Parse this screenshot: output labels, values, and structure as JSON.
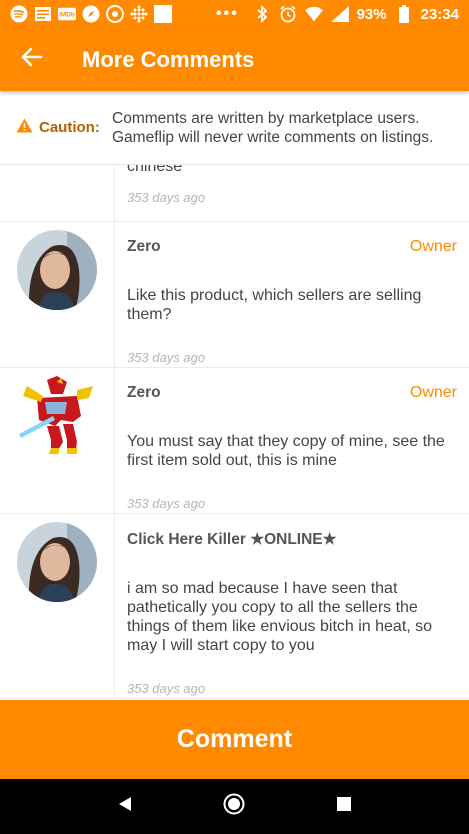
{
  "status_bar": {
    "battery": "93%",
    "time": "23:34",
    "dots": "•••"
  },
  "app_bar": {
    "title": "More Comments"
  },
  "caution": {
    "label": "Caution:",
    "text_line1": "Comments are written by marketplace users.",
    "text_line2": "Gameflip will never write comments on listings."
  },
  "comments": [
    {
      "text": "chinese",
      "time": "353 days ago"
    },
    {
      "author": "Zero",
      "role": "Owner",
      "text": "Like this product, which sellers are selling them?",
      "time": "353 days ago"
    },
    {
      "author": "Zero",
      "role": "Owner",
      "text": "You must say that they copy of mine, see the first item sold out, this is mine",
      "time": "353 days ago"
    },
    {
      "author": "Click Here Killer ★ONLINE★",
      "text": "i am so mad because I have seen that pathetically you copy to all the sellers the things of them like envious bitch in heat, so may I will start copy to you",
      "time": "353 days ago"
    }
  ],
  "comment_button": {
    "label": "Comment"
  },
  "colors": {
    "accent": "#ff8a00",
    "caution_label": "#b76000"
  }
}
